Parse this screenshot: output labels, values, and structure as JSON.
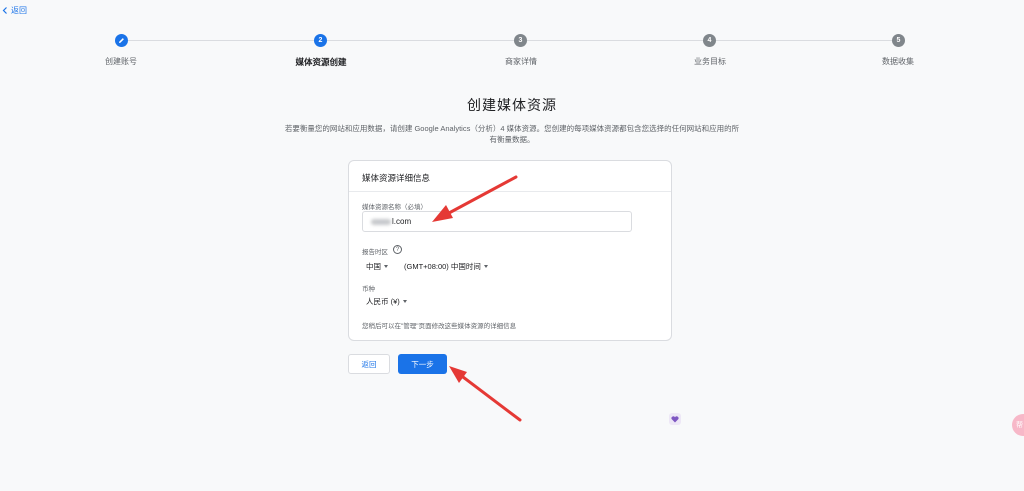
{
  "nav": {
    "back_label": "返回"
  },
  "steps": [
    {
      "number": "",
      "label": "创建账号",
      "state": "done"
    },
    {
      "number": "2",
      "label": "媒体资源创建",
      "state": "active"
    },
    {
      "number": "3",
      "label": "商家详情",
      "state": "todo"
    },
    {
      "number": "4",
      "label": "业务目标",
      "state": "todo"
    },
    {
      "number": "5",
      "label": "数据收集",
      "state": "todo"
    }
  ],
  "title": "创建媒体资源",
  "subtitle": "若要衡量您的网站和应用数据，请创建 Google Analytics（分析）4 媒体资源。您创建的每项媒体资源都包含您选择的任何网站和应用的所有衡量数据。",
  "card": {
    "header": "媒体资源详细信息",
    "name_label": "媒体资源名称（必填）",
    "name_value_suffix": "l.com",
    "timezone_label": "报告时区",
    "help_glyph": "?",
    "country_value": "中国",
    "timezone_value": "(GMT+08:00) 中国时间",
    "currency_label": "币种",
    "currency_value": "人民币 (¥)",
    "note": "您稍后可以在\"管理\"页面修改这些媒体资源的详细信息"
  },
  "buttons": {
    "back": "返回",
    "next": "下一步"
  },
  "side_bubble": "帮",
  "colors": {
    "accent": "#1a73e8",
    "annotation_arrow": "#e53935"
  }
}
